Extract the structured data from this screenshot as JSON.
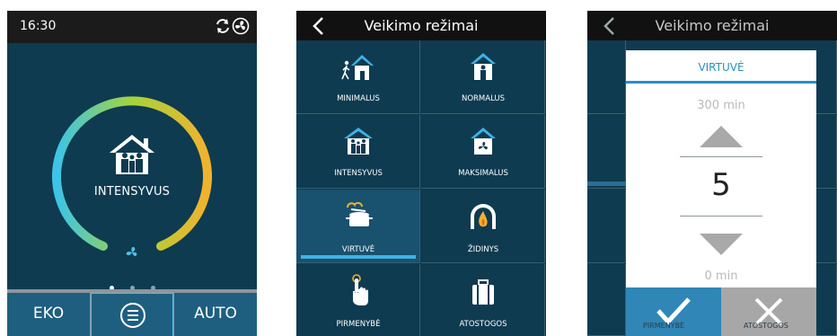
{
  "screen1": {
    "time": "16:30",
    "status_icons": [
      "refresh-icon",
      "fan-icon"
    ],
    "mode_label": "INTENSYVUS",
    "page_dots": 3,
    "active_dot": 1,
    "buttons": {
      "left": "EKO",
      "middle_icon": "menu-icon",
      "right": "AUTO"
    },
    "colors": {
      "bg": "#0f3b50",
      "ring_start": "#3cc4e8",
      "ring_mid": "#a4d43c",
      "ring_end": "#f1b22d",
      "active_dot": "#ffffff"
    }
  },
  "screen2": {
    "title": "Veikimo režimai",
    "modes": [
      {
        "label": "MINIMALUS",
        "icon": "walking-person-house-icon"
      },
      {
        "label": "NORMALUS",
        "icon": "person-house-icon"
      },
      {
        "label": "INTENSYVUS",
        "icon": "family-house-icon"
      },
      {
        "label": "MAKSIMALUS",
        "icon": "fan-house-icon"
      },
      {
        "label": "VIRTUVĖ",
        "icon": "cooking-pot-icon",
        "selected": true
      },
      {
        "label": "ŽIDINYS",
        "icon": "fireplace-icon"
      },
      {
        "label": "PIRMENYBĖ",
        "icon": "hand-pointer-icon"
      },
      {
        "label": "ATOSTOGOS",
        "icon": "suitcase-icon"
      }
    ],
    "colors": {
      "accent": "#3db3e7",
      "selected_bg": "#18526f"
    }
  },
  "screen3": {
    "title": "Veikimo režimai",
    "dialog": {
      "title": "VIRTUVĖ",
      "max_label": "300 min",
      "value": "5",
      "min_label": "0 min"
    },
    "under_labels": {
      "left": "PIRMENYBĖ",
      "right": "ATOSTOGOS"
    },
    "colors": {
      "confirm": "#2f86b7",
      "cancel": "#a7a7a7",
      "accent": "#2a8fc4"
    }
  }
}
